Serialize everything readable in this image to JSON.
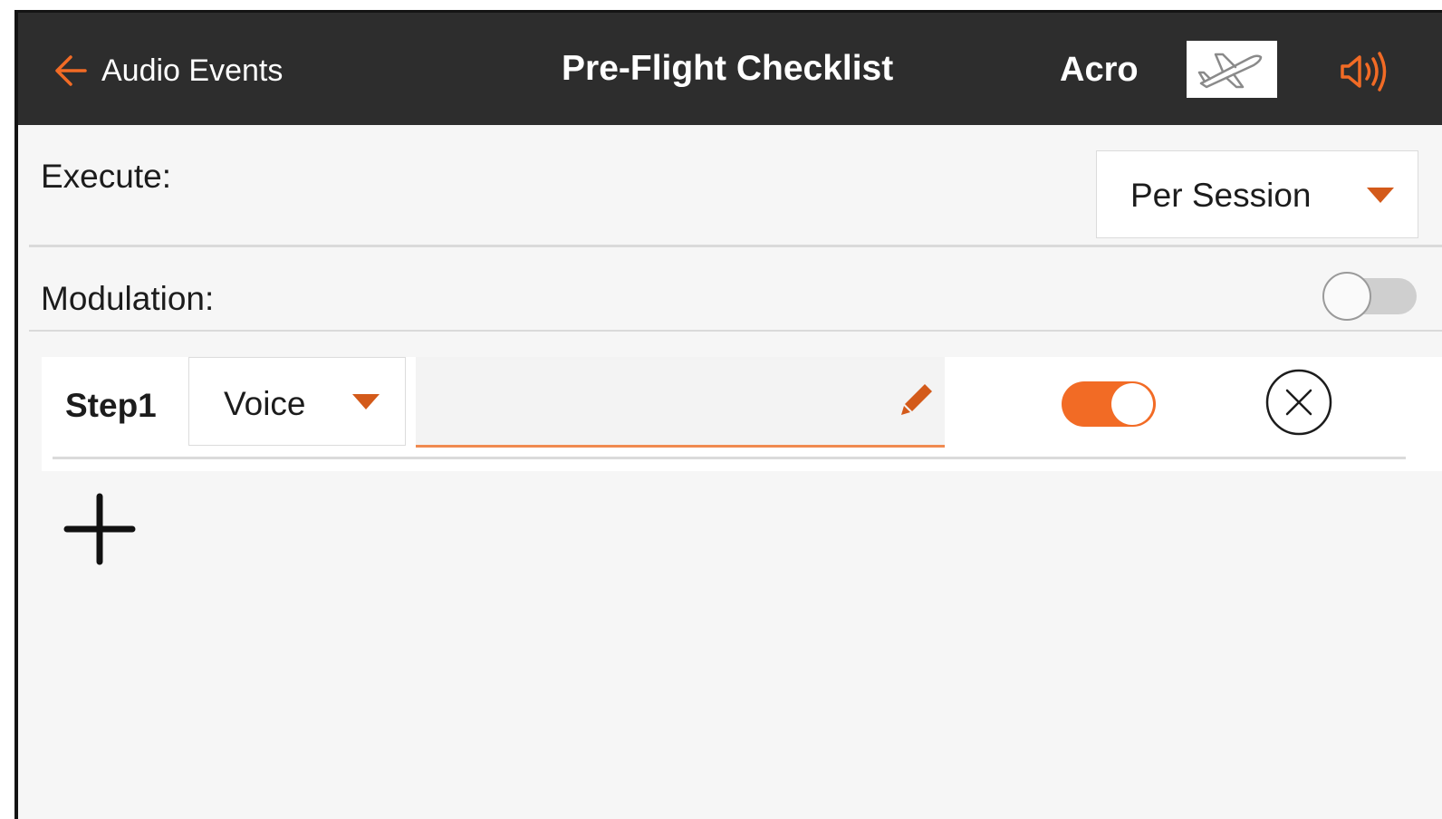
{
  "header": {
    "back_label": "Audio Events",
    "title": "Pre-Flight Checklist",
    "mode": "Acro",
    "model_icon": "airplane-icon",
    "speaker_icon": "speaker-volume-icon"
  },
  "execute": {
    "label": "Execute:",
    "value": "Per Session"
  },
  "modulation": {
    "label": "Modulation:",
    "enabled": false
  },
  "steps": [
    {
      "label": "Step1",
      "type": "Voice",
      "text": "",
      "enabled": true
    }
  ],
  "colors": {
    "accent": "#f26b25",
    "header_bg": "#2d2d2d",
    "page_bg": "#f6f6f6"
  }
}
